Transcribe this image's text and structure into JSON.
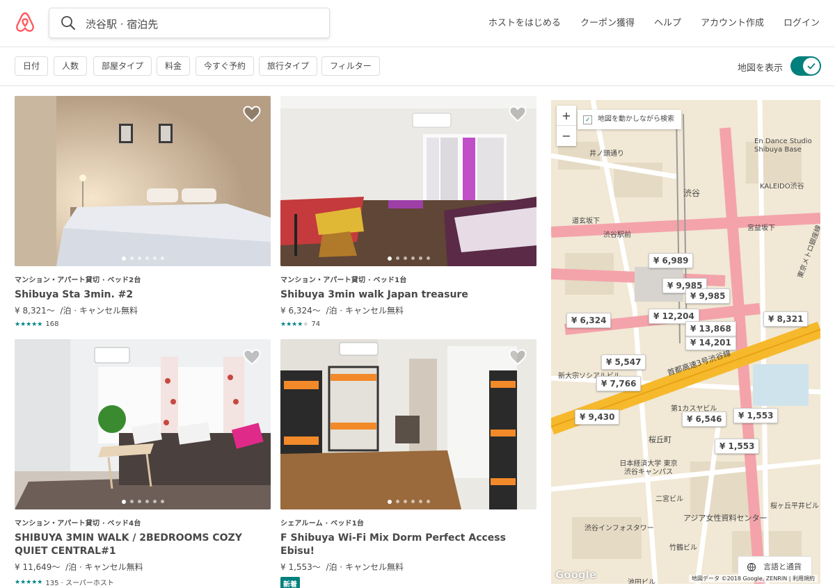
{
  "header": {
    "search_placeholder": "渋谷駅 · 宿泊先",
    "nav": [
      "ホストをはじめる",
      "クーポン獲得",
      "ヘルプ",
      "アカウント作成",
      "ログイン"
    ]
  },
  "filters": [
    "日付",
    "人数",
    "部屋タイプ",
    "料金",
    "今すぐ予約",
    "旅行タイプ",
    "フィルター"
  ],
  "map_toggle": {
    "label": "地図を表示",
    "on": true
  },
  "listings": [
    {
      "kind": "マンション・アパート貸切 · ベッド2台",
      "title": "Shibuya Sta 3min. #2",
      "price": "¥ 8,321〜",
      "price_suffix": "/泊 · キャンセル無料",
      "rating_stars": 4.5,
      "reviews": "168",
      "extra": ""
    },
    {
      "kind": "マンション・アパート貸切 · ベッド1台",
      "title": "Shibuya 3min walk Japan treasure",
      "price": "¥ 6,324〜",
      "price_suffix": "/泊 · キャンセル無料",
      "rating_stars": 4,
      "reviews": "74",
      "extra": ""
    },
    {
      "kind": "マンション・アパート貸切 · ベッド4台",
      "title": "SHIBUYA 3MIN WALK / 2BEDROOMS COZY QUIET CENTRAL#1",
      "price": "¥ 11,649〜",
      "price_suffix": "/泊 · キャンセル無料",
      "rating_stars": 4.5,
      "reviews": "135",
      "extra": " · スーパーホスト"
    },
    {
      "kind": "シェアルーム · ベッド1台",
      "title": "F Shibuya Wi-Fi Mix Dorm Perfect Access Ebisu!",
      "price": "¥ 1,553〜",
      "price_suffix": "/泊 · キャンセル無料",
      "badge": "新着"
    }
  ],
  "map": {
    "zoom_in": "+",
    "zoom_out": "−",
    "move_search": "地図を動かしながら検索",
    "pins": [
      "¥ 6,989",
      "¥ 9,985",
      "¥ 9,985",
      "¥ 12,204",
      "¥ 6,324",
      "¥ 8,321",
      "¥ 14,201",
      "¥ 13,868",
      "¥ 5,547",
      "¥ 7,766",
      "¥ 9,430",
      "¥ 6,546",
      "¥ 1,553",
      "¥ 1,553"
    ],
    "labels": [
      "井ノ頭通り",
      "渋谷",
      "宮益坂下",
      "道玄坂下",
      "渋谷駅前",
      "首都高速3号渋谷線",
      "桜丘町",
      "日本経済大学 東京渋谷キャンパス",
      "アジア女性資料センター",
      "渋谷インフォスタワー",
      "En Dance Studio Shibuya Base",
      "KALEIDO渋谷",
      "東京メトロ銀座線",
      "二宮ビル",
      "第1カスヤビル",
      "桜ヶ丘平井ビル",
      "新大宗ソシアルビル",
      "池田ビル",
      "竹鶴ビル"
    ],
    "language_button": "言語と通貨",
    "google": "Google",
    "credit": "地図データ ©2018 Google, ZENRIN | 利用規約"
  }
}
